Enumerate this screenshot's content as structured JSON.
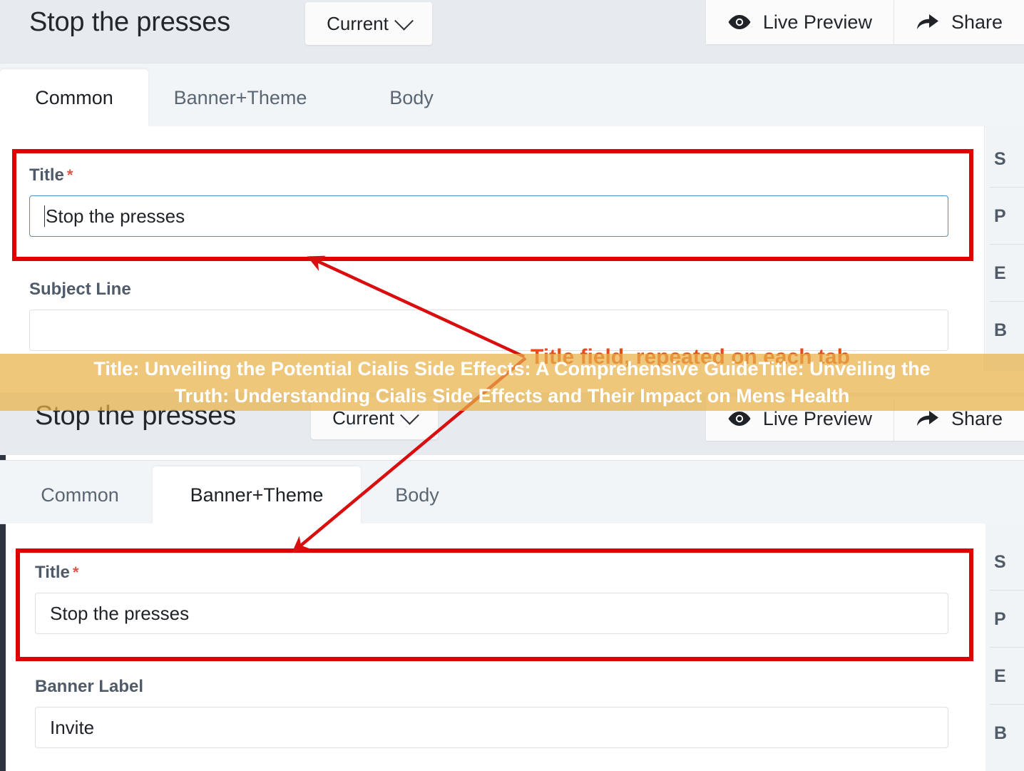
{
  "windows": [
    {
      "title": "Stop the presses",
      "version_selector": {
        "label": "Current",
        "icon": "chevron-down-icon"
      },
      "actions": [
        {
          "label": "Live Preview",
          "icon": "eye-icon"
        },
        {
          "label": "Share",
          "icon": "share-arrow-icon"
        }
      ],
      "tabs": [
        {
          "label": "Common",
          "active": true
        },
        {
          "label": "Banner+Theme",
          "active": false
        },
        {
          "label": "Body",
          "active": false
        }
      ],
      "fields": [
        {
          "label": "Title",
          "required": true,
          "value": "Stop the presses",
          "focused": true
        },
        {
          "label": "Subject Line",
          "required": false,
          "value": "",
          "focused": false
        }
      ],
      "rail": [
        "S",
        "P",
        "E",
        "B"
      ]
    },
    {
      "title": "Stop the presses",
      "version_selector": {
        "label": "Current",
        "icon": "chevron-down-icon"
      },
      "actions": [
        {
          "label": "Live Preview",
          "icon": "eye-icon"
        },
        {
          "label": "Share",
          "icon": "share-arrow-icon"
        }
      ],
      "tabs": [
        {
          "label": "Common",
          "active": false
        },
        {
          "label": "Banner+Theme",
          "active": true
        },
        {
          "label": "Body",
          "active": false
        }
      ],
      "fields": [
        {
          "label": "Title",
          "required": true,
          "value": "Stop the presses",
          "focused": false
        },
        {
          "label": "Banner Label",
          "required": false,
          "value": "Invite",
          "focused": false
        }
      ],
      "rail": [
        "S",
        "P",
        "E",
        "B"
      ]
    }
  ],
  "annotations": {
    "callout_text": "Title field, repeated on each tab",
    "box_color": "#e00000",
    "text_color": "#e8491d"
  },
  "caption_band": {
    "background_color": "#e8b248",
    "text_color": "#ffffff",
    "lines": [
      "Title: Unveiling the Potential Cialis Side Effects: A Comprehensive GuideTitle: Unveiling the",
      "Truth: Understanding Cialis Side Effects and Their Impact on Mens Health"
    ]
  }
}
